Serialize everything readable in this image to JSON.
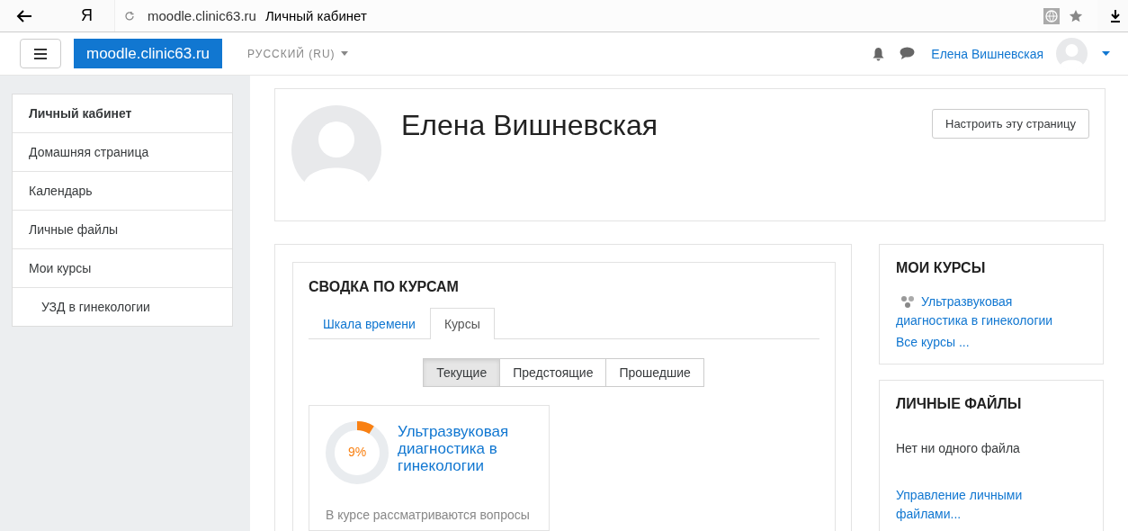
{
  "browser": {
    "url": "moodle.clinic63.ru",
    "page_title": "Личный кабинет",
    "logo": "Я"
  },
  "navbar": {
    "site_name": "moodle.clinic63.ru",
    "language": "РУССКИЙ (RU)",
    "user_name": "Елена Вишневская"
  },
  "sidebar": {
    "items": [
      {
        "label": "Личный кабинет",
        "selected": true
      },
      {
        "label": "Домашняя страница",
        "selected": false
      },
      {
        "label": "Календарь",
        "selected": false
      },
      {
        "label": "Личные файлы",
        "selected": false
      },
      {
        "label": "Мои курсы",
        "selected": false,
        "children": [
          {
            "label": "УЗД в гинекологии",
            "selected": false
          }
        ]
      }
    ]
  },
  "header": {
    "name": "Елена Вишневская",
    "customize_button": "Настроить эту страницу"
  },
  "course_overview": {
    "title": "СВОДКА ПО КУРСАМ",
    "tabs": [
      {
        "label": "Шкала времени",
        "selected": false
      },
      {
        "label": "Курсы",
        "selected": true
      }
    ],
    "filters": [
      {
        "label": "Текущие",
        "selected": true
      },
      {
        "label": "Предстоящие",
        "selected": false
      },
      {
        "label": "Прошедшие",
        "selected": false
      }
    ],
    "courses": [
      {
        "name": "Ультразвуковая диагностика в гинекологии",
        "level": 0.09,
        "percent": "9%",
        "summary": "В курсе рассматриваются вопросы"
      }
    ]
  },
  "my_courses": {
    "title": "МОИ КУРСЫ",
    "items": [
      "Ультразвуковая диагностика в гинекологии"
    ],
    "all_link": "Все курсы ..."
  },
  "private_files": {
    "title": "ЛИЧНЫЕ ФАЙЛЫ",
    "empty_text": "Нет ни одного файла",
    "manage_link": "Управление личными файлами..."
  }
}
